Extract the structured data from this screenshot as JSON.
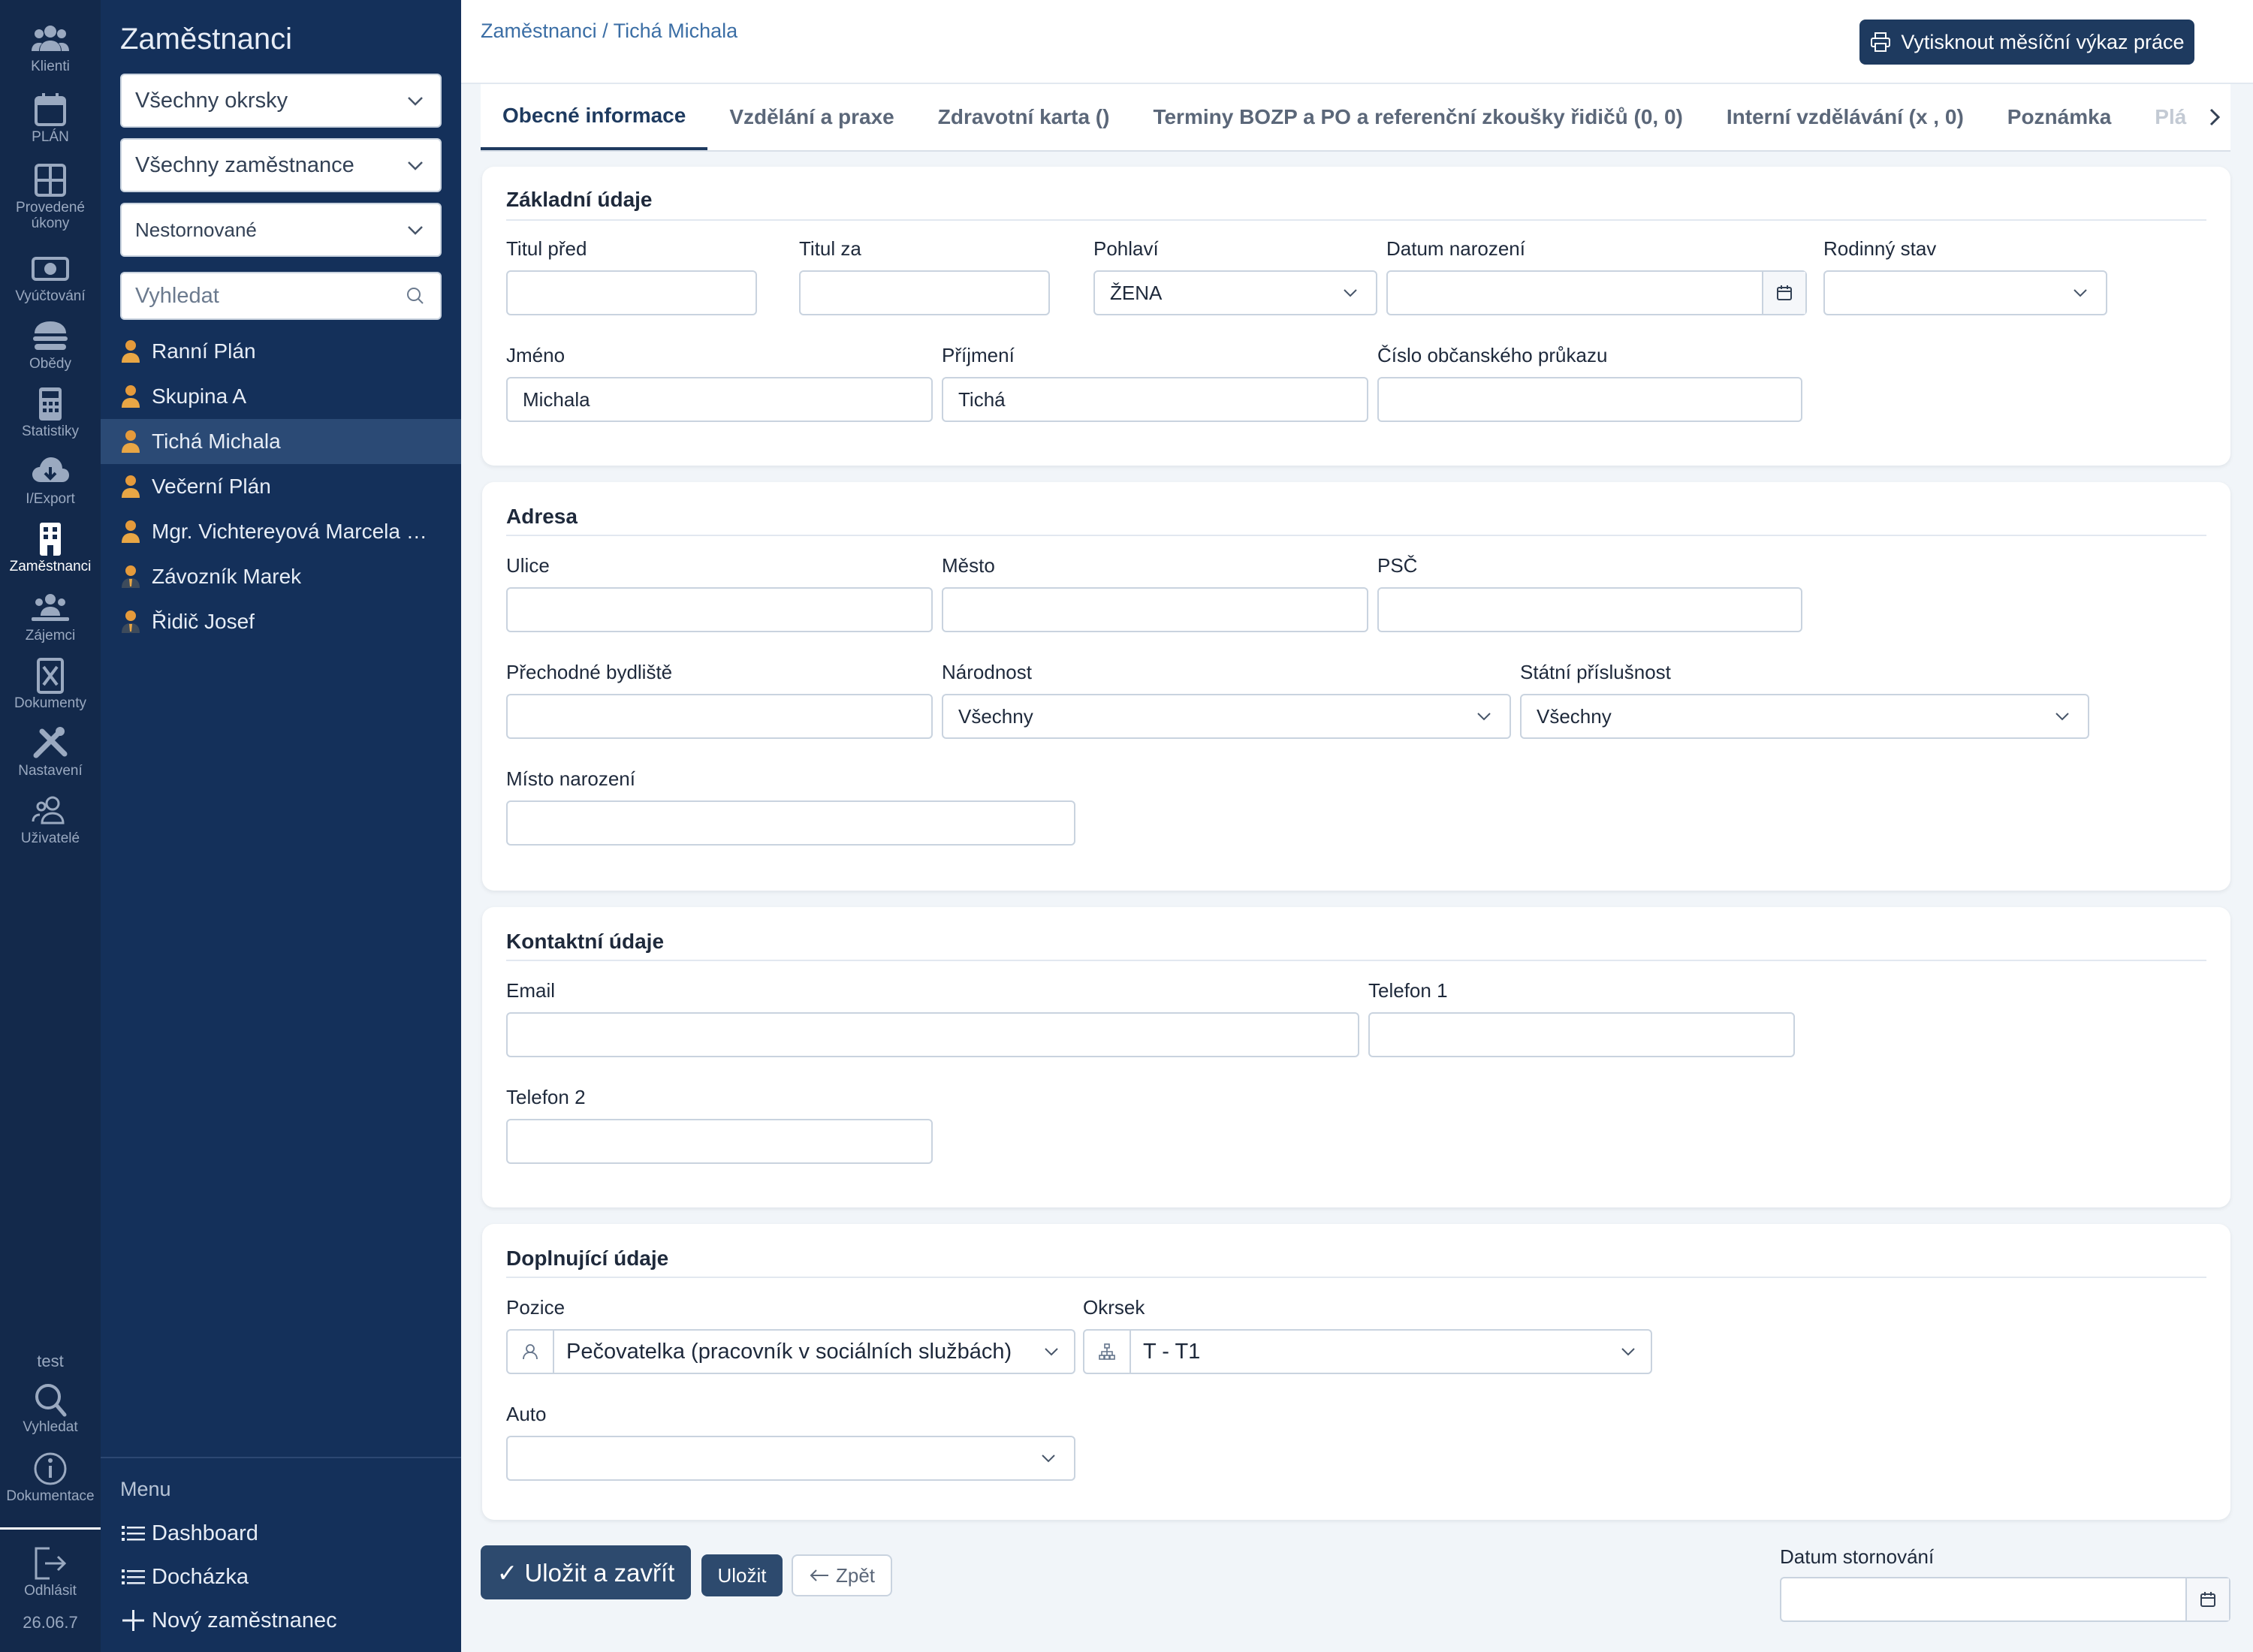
{
  "rail": {
    "items": [
      {
        "label": "Klienti",
        "icon": "people-icon"
      },
      {
        "label": "PLÁN",
        "icon": "calendar-icon"
      },
      {
        "label": "Provedené úkony",
        "icon": "grid-icon"
      },
      {
        "label": "Vyúčtování",
        "icon": "money-icon"
      },
      {
        "label": "Obědy",
        "icon": "burger-icon"
      },
      {
        "label": "Statistiky",
        "icon": "calculator-icon"
      },
      {
        "label": "I/Export",
        "icon": "cloud-download-icon"
      },
      {
        "label": "Zaměstnanci",
        "icon": "building-icon"
      },
      {
        "label": "Zájemci",
        "icon": "people-group-icon"
      },
      {
        "label": "Dokumenty",
        "icon": "document-x-icon"
      },
      {
        "label": "Nastavení",
        "icon": "tools-icon"
      },
      {
        "label": "Uživatelé",
        "icon": "user-group-icon"
      }
    ],
    "env": "test",
    "search_label": "Vyhledat",
    "docs_label": "Dokumentace",
    "logout_label": "Odhlásit",
    "version": "26.06.7",
    "active": "Zaměstnanci"
  },
  "side": {
    "title": "Zaměstnanci",
    "filter_district": "Všechny okrsky",
    "filter_employees": "Všechny zaměstnance",
    "filter_status": "Nestornované",
    "search_placeholder": "Vyhledat",
    "employees": [
      {
        "name": "Ranní Plán",
        "active": false
      },
      {
        "name": "Skupina A",
        "active": false
      },
      {
        "name": "Tichá Michala",
        "active": true
      },
      {
        "name": "Večerní Plán",
        "active": false
      },
      {
        "name": "Mgr. Vichtereyová Marcela …",
        "active": false
      },
      {
        "name": "Závozník Marek",
        "active": false
      },
      {
        "name": "Řidič Josef",
        "active": false
      }
    ],
    "menu_title": "Menu",
    "menu_items": [
      "Dashboard",
      "Docházka",
      "Nový zaměstnanec"
    ]
  },
  "header": {
    "breadcrumb": "Zaměstnanci / Tichá Michala",
    "print_label": "Vytisknout měsíční výkaz práce"
  },
  "tabs": [
    {
      "label": "Obecné informace",
      "active": true
    },
    {
      "label": "Vzdělání a praxe",
      "active": false
    },
    {
      "label": "Zdravotní karta ()",
      "active": false
    },
    {
      "label": "Terminy BOZP a PO a referenční zkoušky řidičů (0, 0)",
      "active": false
    },
    {
      "label": "Interní vzdělávání (x , 0)",
      "active": false
    },
    {
      "label": "Poznámka",
      "active": false
    },
    {
      "label": "Plá",
      "active": false
    }
  ],
  "basic": {
    "title": "Základní údaje",
    "titul_pred": {
      "label": "Titul před",
      "value": ""
    },
    "titul_za": {
      "label": "Titul za",
      "value": ""
    },
    "pohlavi": {
      "label": "Pohlaví",
      "value": "ŽENA"
    },
    "datum_narozeni": {
      "label": "Datum narození",
      "value": ""
    },
    "rodinny_stav": {
      "label": "Rodinný stav",
      "value": ""
    },
    "jmeno": {
      "label": "Jméno",
      "value": "Michala"
    },
    "prijmeni": {
      "label": "Příjmení",
      "value": "Tichá"
    },
    "op": {
      "label": "Číslo občanského průkazu",
      "value": ""
    }
  },
  "address": {
    "title": "Adresa",
    "ulice": {
      "label": "Ulice",
      "value": ""
    },
    "mesto": {
      "label": "Město",
      "value": ""
    },
    "psc": {
      "label": "PSČ",
      "value": ""
    },
    "prechodne": {
      "label": "Přechodné bydliště",
      "value": ""
    },
    "narodnost": {
      "label": "Národnost",
      "value": "Všechny"
    },
    "statni": {
      "label": "Státní příslušnost",
      "value": "Všechny"
    },
    "misto_narozeni": {
      "label": "Místo narození",
      "value": ""
    }
  },
  "contact": {
    "title": "Kontaktní údaje",
    "email": {
      "label": "Email",
      "value": ""
    },
    "telefon1": {
      "label": "Telefon 1",
      "value": ""
    },
    "telefon2": {
      "label": "Telefon 2",
      "value": ""
    }
  },
  "extra": {
    "title": "Doplnující údaje",
    "pozice": {
      "label": "Pozice",
      "value": "Pečovatelka (pracovník v sociálních službách)"
    },
    "okrsek": {
      "label": "Okrsek",
      "value": "T - T1"
    },
    "auto": {
      "label": "Auto",
      "value": ""
    }
  },
  "actions": {
    "save_close": "✓ Uložit a zavřít",
    "save": "Uložit",
    "back": "Zpět",
    "storno_label": "Datum stornování",
    "storno_value": ""
  },
  "colors": {
    "rail_bg": "#13294b",
    "side_bg": "#14305a",
    "primary": "#1e3a5f",
    "link": "#3b6ea5"
  }
}
